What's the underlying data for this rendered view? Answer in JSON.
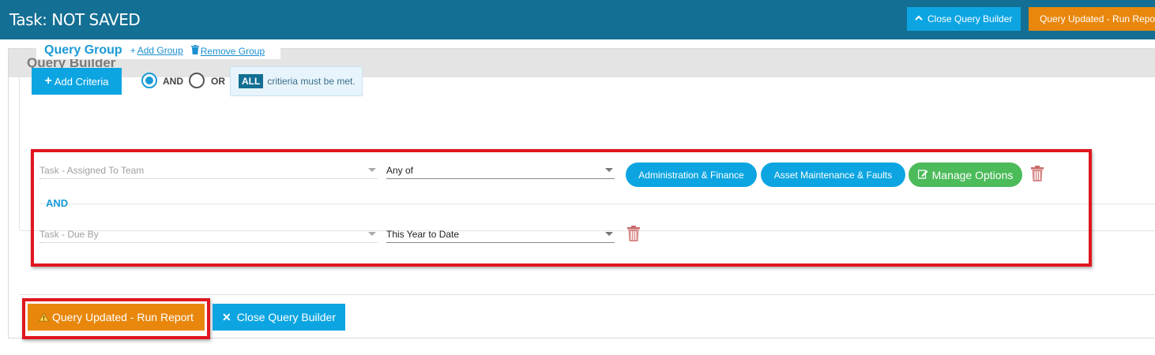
{
  "header": {
    "title": "Task: NOT SAVED",
    "close_query_builder": "Close Query Builder",
    "run_report": "Query Updated - Run Report"
  },
  "panel": {
    "title": "Query Builder"
  },
  "group": {
    "title": "Query Group",
    "add_group": "Add Group",
    "remove_group": "Remove Group",
    "add_criteria": "Add Criteria",
    "logic_options": [
      "AND",
      "OR"
    ],
    "selected_logic": "AND",
    "info_badge": "ALL",
    "info_text": "critieria must be met."
  },
  "criteria": [
    {
      "field": "Task - Assigned To Team",
      "operator": "Any of",
      "values": [
        "Administration & Finance",
        "Asset Maintenance & Faults"
      ],
      "manage_options": "Manage Options"
    },
    {
      "field": "Task - Due By",
      "operator": "This Year to Date"
    }
  ],
  "join_label": "AND",
  "footer": {
    "run_report": "Query Updated - Run Report",
    "close_query_builder": "Close Query Builder"
  },
  "colors": {
    "header_bg": "#136f93",
    "primary": "#0ca5e2",
    "warning": "#e8870c",
    "success": "#4cbb5a",
    "highlight": "#e0161e",
    "link": "#1a9ad6"
  },
  "icons": {
    "close_header": "chevron-up-icon",
    "warning": "warning-triangle-icon",
    "trash": "trash-icon",
    "edit": "edit-icon",
    "close": "close-x-icon"
  }
}
